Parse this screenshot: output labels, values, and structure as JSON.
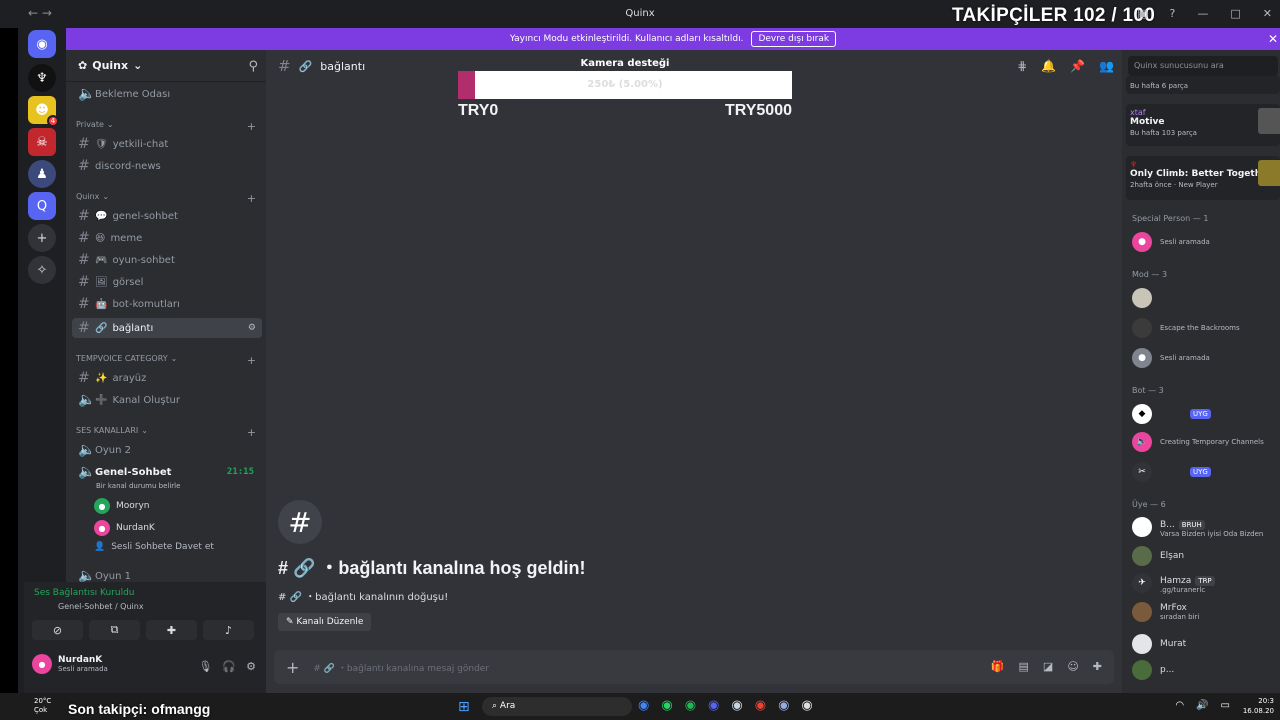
{
  "window": {
    "title": "Quinx"
  },
  "overlay": {
    "followers": "TAKİPÇİLER 102 / 100",
    "last_follower": "Son takipçi: ofmangg"
  },
  "banner": {
    "text": "Yayıncı Modu etkinleştirildi. Kullanıcı adları kısaltıldı.",
    "button": "Devre dışı bırak"
  },
  "server": {
    "name": "Quinx"
  },
  "channels": {
    "afk": "Bekleme Odası",
    "cat_private": "Private",
    "private_items": [
      "yetkili-chat",
      "discord-news"
    ],
    "cat_quinx": "Quinx",
    "quinx_items": [
      "genel-sohbet",
      "meme",
      "oyun-sohbet",
      "görsel",
      "bot-komutları",
      "bağlantı"
    ],
    "cat_temp": "TEMPVOICE CATEGORY",
    "temp_items": [
      "arayüz",
      "Kanal Oluştur"
    ],
    "cat_voice": "SES KANALLARI",
    "voice_items": [
      "Oyun 2",
      "Genel-Sohbet",
      "Oyun 1"
    ],
    "voice_timer": "21:15",
    "voice_status_hint": "Bir kanal durumu belirle",
    "voice_users": [
      "Mooryn",
      "NurdanK"
    ],
    "invite": "Sesli Sohbete Davet et"
  },
  "voice_panel": {
    "status": "Ses Bağlantısı Kuruldu",
    "sub": "Genel-Sohbet / Quinx",
    "user": "NurdanK",
    "user_status": "Sesli aramada"
  },
  "main": {
    "channel": "bağlantı",
    "welcome_title": "# 🔗 ・bağlantı kanalına hoş geldin!",
    "welcome_sub": "# 🔗 ・bağlantı kanalının doğuşu!",
    "edit_button": "Kanalı Düzenle",
    "composer_placeholder": "# 🔗 ・bağlantı kanalına mesaj gönder"
  },
  "donation": {
    "title": "Kamera desteği",
    "progress_text": "250₺ (5.00%)",
    "progress_fraction": 0.05,
    "min": "TRY0",
    "max": "TRY5000",
    "fill_color": "#b22d6c"
  },
  "members": {
    "search_placeholder": "Quinx sunucusunu ara",
    "activities": [
      {
        "line0": "",
        "title": "",
        "sub": "Bu hafta 6 parça"
      },
      {
        "line0": "xtaf",
        "title": "Motive",
        "sub": "Bu hafta 103 parça"
      },
      {
        "line0": "",
        "title": "Only Climb: Better Together",
        "sub": "2hafta önce · New Player"
      }
    ],
    "group_special": "Special Person — 1",
    "special_status": "Sesli aramada",
    "group_mod": "Mod — 3",
    "mod_status_2": "Escape the Backrooms",
    "mod_status_3": "Sesli aramada",
    "group_bot": "Bot — 3",
    "bot_tag": "UYG",
    "bot_status_2": "Creating Temporary Channels",
    "group_member": "Üye — 6",
    "member_names": [
      "B...",
      "Elşan",
      "Hamza",
      "MrFox",
      "Murat",
      "p..."
    ],
    "member_status": [
      "Varsa Bizden iyisi Oda Bizden",
      "",
      ".gg/turanerlc",
      "sıradan biri",
      "",
      ""
    ],
    "member_tag_1": "BRUH",
    "member_tag_3": "TRP"
  },
  "taskbar": {
    "weather_temp": "20°C",
    "weather_desc": "Çok",
    "search": "Ara",
    "time": "20:3",
    "date": "16.08.20"
  },
  "colors": {
    "accent": "#5865f2",
    "online": "#23a55a",
    "banner": "#7c3ce2"
  }
}
